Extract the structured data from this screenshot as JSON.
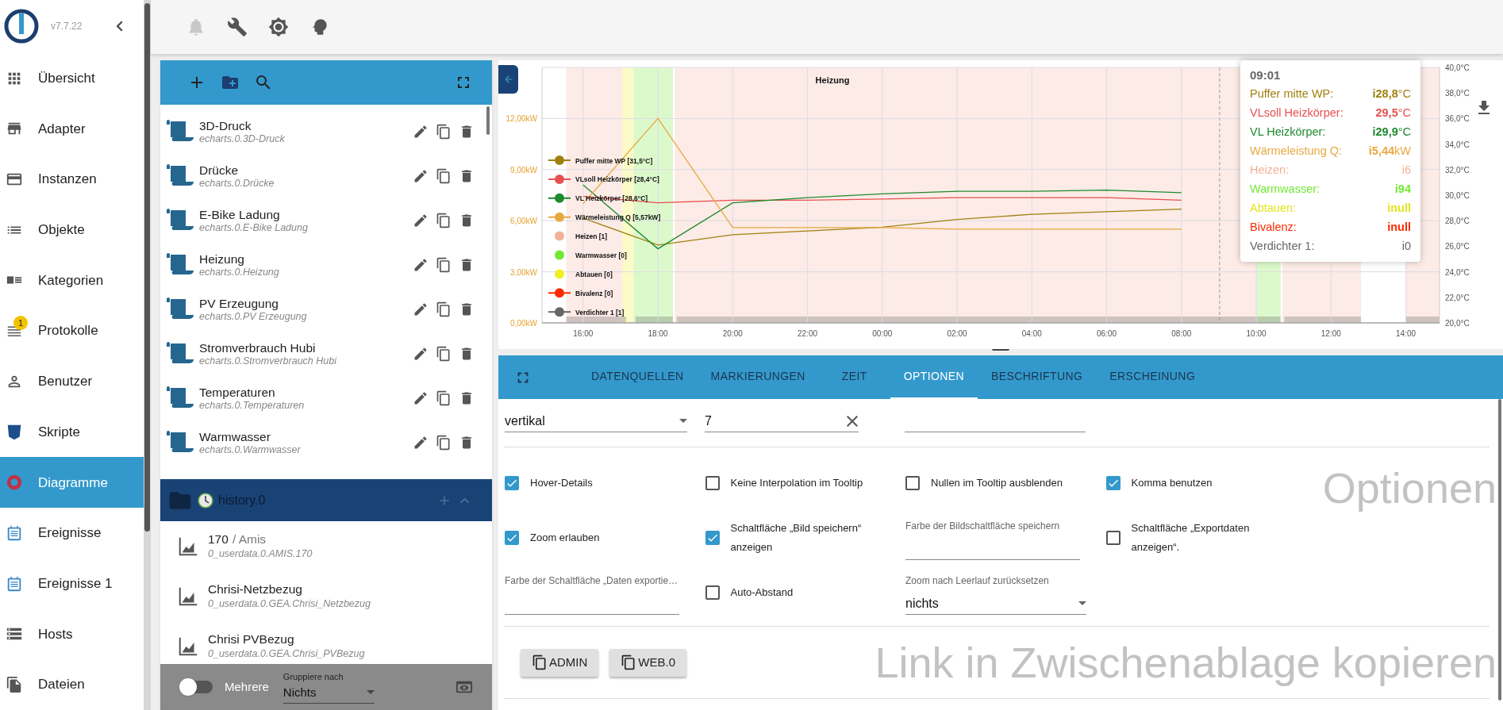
{
  "sidebar": {
    "version": "v7.7.22",
    "items": [
      {
        "label": "Übersicht",
        "selected": false
      },
      {
        "label": "Adapter",
        "selected": false
      },
      {
        "label": "Instanzen",
        "selected": false
      },
      {
        "label": "Objekte",
        "selected": false
      },
      {
        "label": "Kategorien",
        "selected": false
      },
      {
        "label": "Protokolle",
        "selected": false,
        "badge": "1"
      },
      {
        "label": "Benutzer",
        "selected": false
      },
      {
        "label": "Skripte",
        "selected": false
      },
      {
        "label": "Diagramme",
        "selected": true
      },
      {
        "label": "Ereignisse",
        "selected": false
      },
      {
        "label": "Ereignisse 1",
        "selected": false
      },
      {
        "label": "Hosts",
        "selected": false
      },
      {
        "label": "Dateien",
        "selected": false
      }
    ]
  },
  "toolbar": {
    "buttons": [
      {
        "disabled": true
      },
      {
        "disabled": false
      },
      {
        "disabled": false
      },
      {
        "disabled": false
      }
    ]
  },
  "chart_list": {
    "items": [
      {
        "name": "3D-Druck",
        "id": "echarts.0.3D-Druck"
      },
      {
        "name": "Drücke",
        "id": "echarts.0.Drücke"
      },
      {
        "name": "E-Bike Ladung",
        "id": "echarts.0.E-Bike Ladung"
      },
      {
        "name": "Heizung",
        "id": "echarts.0.Heizung"
      },
      {
        "name": "PV Erzeugung",
        "id": "echarts.0.PV Erzeugung"
      },
      {
        "name": "Stromverbrauch Hubi",
        "id": "echarts.0.Stromverbrauch Hubi"
      },
      {
        "name": "Temperaturen",
        "id": "echarts.0.Temperaturen"
      },
      {
        "name": "Warmwasser",
        "id": "echarts.0.Warmwasser"
      }
    ],
    "group": {
      "label": "history.0",
      "expanded": true,
      "items": [
        {
          "name": "170",
          "alias": "/ Amis",
          "id": "0_userdata.0.AMIS.170"
        },
        {
          "name": "Chrisi-Netzbezug",
          "id": "0_userdata.0.GEA.Chrisi_Netzbezug"
        },
        {
          "name": "Chrisi PVBezug",
          "id": "0_userdata.0.GEA.Chrisi_PVBezug"
        }
      ]
    },
    "footer": {
      "multiple_label": "Mehrere",
      "multiple_on": false,
      "group_by_label": "Gruppiere nach",
      "group_by_value": "Nichts"
    }
  },
  "chart": {
    "chart_data": {
      "type": "line",
      "title": "Heizung",
      "categories": [
        "16:00",
        "18:00",
        "20:00",
        "22:00",
        "00:00",
        "02:00",
        "04:00",
        "06:00",
        "08:00",
        "10:00",
        "12:00",
        "14:00"
      ],
      "series": [
        {
          "name": "Puffer mitte WP",
          "color": "#a08010",
          "axis": "y2",
          "values": [
            28.2,
            26.1,
            26.9,
            27.2,
            27.5,
            28.1,
            28.5,
            28.7,
            28.9,
            null,
            null,
            null
          ]
        },
        {
          "name": "VLsoll Heizkörper",
          "color": "#e85050",
          "axis": "y2",
          "values": [
            29.9,
            29.4,
            29.6,
            29.6,
            29.7,
            29.8,
            29.8,
            29.8,
            29.6,
            null,
            null,
            null
          ]
        },
        {
          "name": "VL Heizkörper",
          "color": "#1e8a2e",
          "axis": "y2",
          "values": [
            30.8,
            25.8,
            29.4,
            29.8,
            30.1,
            30.3,
            30.3,
            30.4,
            30.2,
            null,
            null,
            null
          ]
        },
        {
          "name": "Wärmeleistung Q",
          "color": "#e8a840",
          "values": [
            7.0,
            12.0,
            5.6,
            5.6,
            5.6,
            5.5,
            5.5,
            5.5,
            5.5,
            null,
            null,
            null
          ]
        }
      ],
      "ylim": [
        0,
        15
      ],
      "y2lim": [
        20,
        40
      ],
      "grid": true,
      "yticks": [
        {
          "value": 0,
          "label": "0,00kW"
        },
        {
          "value": 3,
          "label": "3,00kW"
        },
        {
          "value": 6,
          "label": "6,00kW"
        },
        {
          "value": 9,
          "label": "9,00kW"
        },
        {
          "value": 12,
          "label": "12,00kW"
        }
      ],
      "y2ticks": [
        {
          "value": 20,
          "label": "20,0°C"
        },
        {
          "value": 22,
          "label": "22,0°C"
        },
        {
          "value": 24,
          "label": "24,0°C"
        },
        {
          "value": 26,
          "label": "26,0°C"
        },
        {
          "value": 28,
          "label": "28,0°C"
        },
        {
          "value": 30,
          "label": "30,0°C"
        },
        {
          "value": 32,
          "label": "32,0°C"
        },
        {
          "value": 34,
          "label": "34,0°C"
        },
        {
          "value": 36,
          "label": "36,0°C"
        },
        {
          "value": 38,
          "label": "38,0°C"
        },
        {
          "value": 40,
          "label": "40,0°C"
        }
      ]
    },
    "legend": [
      {
        "reading": "[31,5°C]",
        "color": "#a08010",
        "kind": "line"
      },
      {
        "reading": "[28,4°C]",
        "color": "#e85050",
        "kind": "line"
      },
      {
        "reading": "[28,6°C]",
        "color": "#1e8a2e",
        "kind": "line"
      },
      {
        "reading": "[5,57kW]",
        "color": "#e8a840",
        "kind": "line"
      },
      {
        "label": "Heizen",
        "reading": "[1]",
        "color": "#f4b09a",
        "kind": "dot"
      },
      {
        "label": "Warmwasser",
        "reading": "[0]",
        "color": "#72e832",
        "kind": "dot"
      },
      {
        "label": "Abtauen",
        "reading": "[0]",
        "color": "#eeee22",
        "kind": "dot"
      },
      {
        "label": "Bivalenz",
        "reading": "[0]",
        "color": "#ff2a00",
        "kind": "line"
      },
      {
        "label": "Verdichter 1",
        "reading": "[1]",
        "color": "#666666",
        "kind": "line"
      }
    ],
    "tooltip": {
      "time": "09:01",
      "rows": [
        {
          "label": "Puffer mitte WP:",
          "value": "**i28,8**°C",
          "color": "#a08010"
        },
        {
          "label": "VLsoll Heizkörper:",
          "value": "**29,5**°C",
          "color": "#e85050"
        },
        {
          "label": "VL Heizkörper:",
          "value": "**i29,9**°C",
          "color": "#1e8a2e"
        },
        {
          "label": "Wärmeleistung Q:",
          "value": "**i5,44**kW",
          "color": "#e8a840"
        },
        {
          "label": "Heizen:",
          "value": "i6",
          "color": "#f4b09a"
        },
        {
          "label": "Warmwasser:",
          "value": "**i94**",
          "color": "#72e832"
        },
        {
          "label": "Abtauen:",
          "value": "**inull**",
          "color": "#e4e41a"
        },
        {
          "label": "Bivalenz:",
          "value": "**inull**",
          "color": "#ff2a00"
        },
        {
          "label": "Verdichter 1:",
          "value": "i0",
          "color": "#666666"
        }
      ]
    }
  },
  "tabs": [
    {
      "label": "DATENQUELLEN",
      "selected": false
    },
    {
      "label": "MARKIERUNGEN",
      "selected": false
    },
    {
      "label": "ZEIT",
      "selected": false
    },
    {
      "label": "OPTIONEN",
      "selected": true
    },
    {
      "label": "BESCHRIFTUNG",
      "selected": false
    },
    {
      "label": "ERSCHEINUNG",
      "selected": false
    }
  ],
  "options": {
    "top_fields": [
      {
        "kind": "select",
        "value": "vertikal"
      },
      {
        "kind": "field",
        "value": "7",
        "clearable": true
      },
      {
        "kind": "field"
      }
    ],
    "heading": "Optionen",
    "items": [
      {
        "kind": "checkbox",
        "label": "Hover-Details",
        "checked": true
      },
      {
        "kind": "checkbox",
        "label": "Keine Interpolation im Tooltip",
        "checked": false
      },
      {
        "kind": "checkbox",
        "label": "Nullen im Tooltip ausblenden",
        "checked": false
      },
      {
        "kind": "checkbox",
        "label": "Komma benutzen",
        "checked": true
      },
      {
        "kind": "checkbox",
        "label": "Zoom erlauben",
        "checked": true
      },
      {
        "kind": "checkbox",
        "label": "Schaltfläche „Bild speichern“ anzeigen",
        "checked": true
      },
      {
        "kind": "field",
        "label": "Farbe der Bildschaltfläche speichern"
      },
      {
        "kind": "checkbox",
        "label": "Schaltfläche „Exportdaten anzeigen“.",
        "checked": false
      },
      {
        "kind": "field",
        "label": "Farbe der Schaltfläche „Daten exportie…"
      },
      {
        "kind": "checkbox",
        "label": "Auto-Abstand",
        "checked": false
      },
      {
        "kind": "select",
        "label": "Zoom nach Leerlauf zurücksetzen",
        "value": "nichts"
      }
    ],
    "copy_buttons": [
      "ADMIN",
      "WEB.0"
    ],
    "copy_heading": "Link in Zwischenablage kopieren"
  }
}
